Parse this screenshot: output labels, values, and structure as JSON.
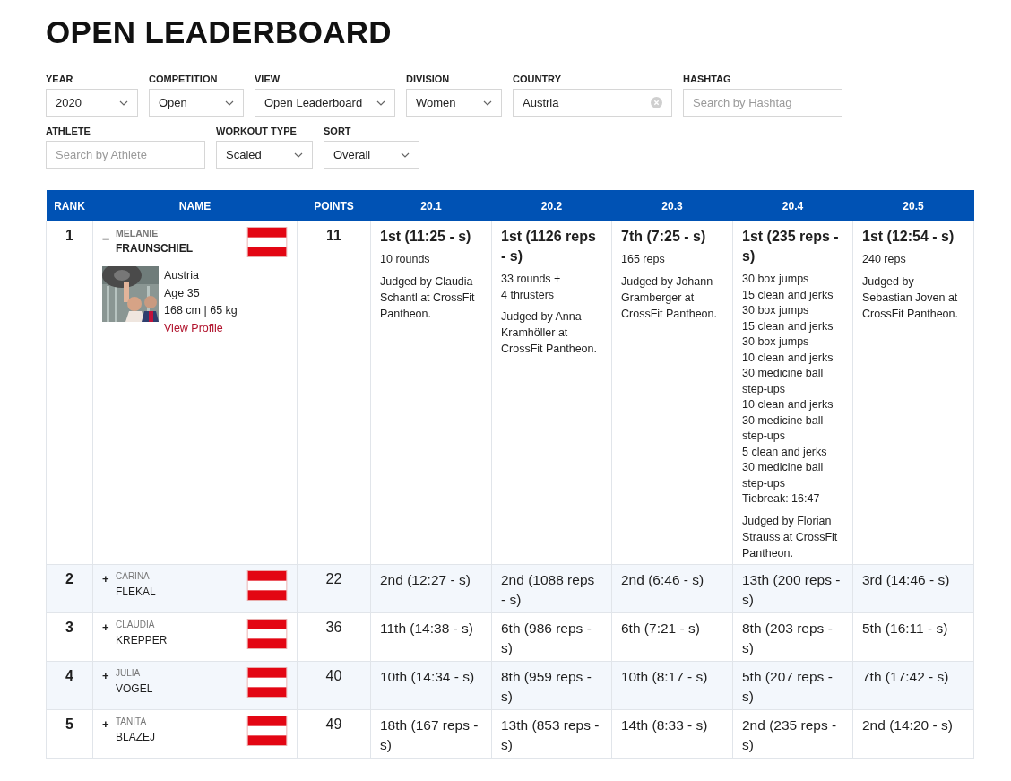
{
  "title": "OPEN LEADERBOARD",
  "filter_rows": [
    [
      {
        "label": "YEAR",
        "kind": "select",
        "value": "2020"
      },
      {
        "label": "COMPETITION",
        "kind": "select",
        "value": "Open"
      },
      {
        "label": "VIEW",
        "kind": "select",
        "value": "Open Leaderboard"
      },
      {
        "label": "DIVISION",
        "kind": "select",
        "value": "Women"
      },
      {
        "label": "COUNTRY",
        "kind": "clearable",
        "value": "Austria"
      },
      {
        "label": "HASHTAG",
        "kind": "search",
        "placeholder": "Search by Hashtag"
      }
    ],
    [
      {
        "label": "ATHLETE",
        "kind": "search",
        "placeholder": "Search by Athlete"
      },
      {
        "label": "WORKOUT TYPE",
        "kind": "select",
        "value": "Scaled"
      },
      {
        "label": "SORT",
        "kind": "select",
        "value": "Overall"
      }
    ]
  ],
  "table": {
    "columns": [
      "RANK",
      "NAME",
      "POINTS",
      "20.1",
      "20.2",
      "20.3",
      "20.4",
      "20.5"
    ],
    "rows": [
      {
        "rank": "1",
        "toggle": "–",
        "expanded": true,
        "first_name": "MELANIE",
        "last_name": "FRAUNSCHIEL",
        "points": "11",
        "profile": {
          "kind": "picture",
          "country": "Austria",
          "age": "Age 35",
          "size": "168 cm | 65 kg",
          "link": "View Profile"
        },
        "scores": [
          {
            "result": "1st (11:25 - s)",
            "details": [
              "10 rounds"
            ],
            "judge": "Judged by Claudia Schantl at CrossFit Pantheon."
          },
          {
            "result": "1st (1126 reps - s)",
            "details": [
              "33 rounds +",
              "4 thrusters"
            ],
            "judge": "Judged by Anna Kramhöller at CrossFit Pantheon."
          },
          {
            "result": "7th (7:25 - s)",
            "details": [
              "165 reps"
            ],
            "judge": "Judged by Johann Gramberger at CrossFit Pantheon."
          },
          {
            "result": "1st (235 reps - s)",
            "details": [
              "30 box jumps",
              "15 clean and jerks",
              "30 box jumps",
              "15 clean and jerks",
              "30 box jumps",
              "10 clean and jerks",
              "30 medicine ball step-ups",
              "10 clean and jerks",
              "30 medicine ball step-ups",
              "5 clean and jerks",
              "30 medicine ball step-ups",
              "Tiebreak: 16:47"
            ],
            "judge": "Judged by Florian Strauss at CrossFit Pantheon."
          },
          {
            "result": "1st (12:54 - s)",
            "details": [
              "240 reps"
            ],
            "judge": "Judged by Sebastian Joven at CrossFit Pantheon."
          }
        ]
      },
      {
        "rank": "2",
        "toggle": "+",
        "expanded": false,
        "first_name": "CARINA",
        "last_name": "FLEKAL",
        "points": "22",
        "scores": [
          {
            "result": "2nd (12:27 - s)"
          },
          {
            "result": "2nd (1088 reps - s)"
          },
          {
            "result": "2nd (6:46 - s)"
          },
          {
            "result": "13th (200 reps - s)"
          },
          {
            "result": "3rd (14:46 - s)"
          }
        ]
      },
      {
        "rank": "3",
        "toggle": "+",
        "expanded": false,
        "first_name": "CLAUDIA",
        "last_name": "KREPPER",
        "points": "36",
        "scores": [
          {
            "result": "11th (14:38 - s)"
          },
          {
            "result": "6th (986 reps - s)"
          },
          {
            "result": "6th (7:21 - s)"
          },
          {
            "result": "8th (203 reps - s)"
          },
          {
            "result": "5th (16:11 - s)"
          }
        ]
      },
      {
        "rank": "4",
        "toggle": "+",
        "expanded": false,
        "first_name": "JULIA",
        "last_name": "VOGEL",
        "points": "40",
        "scores": [
          {
            "result": "10th (14:34 - s)"
          },
          {
            "result": "8th (959 reps - s)"
          },
          {
            "result": "10th (8:17 - s)"
          },
          {
            "result": "5th (207 reps - s)"
          },
          {
            "result": "7th (17:42 - s)"
          }
        ]
      },
      {
        "rank": "5",
        "toggle": "+",
        "expanded": false,
        "first_name": "TANITA",
        "last_name": "BLAZEJ",
        "points": "49",
        "scores": [
          {
            "result": "18th (167 reps - s)"
          },
          {
            "result": "13th (853 reps - s)"
          },
          {
            "result": "14th (8:33 - s)"
          },
          {
            "result": "2nd (235 reps - s)"
          },
          {
            "result": "2nd (14:20 - s)"
          }
        ]
      }
    ]
  }
}
